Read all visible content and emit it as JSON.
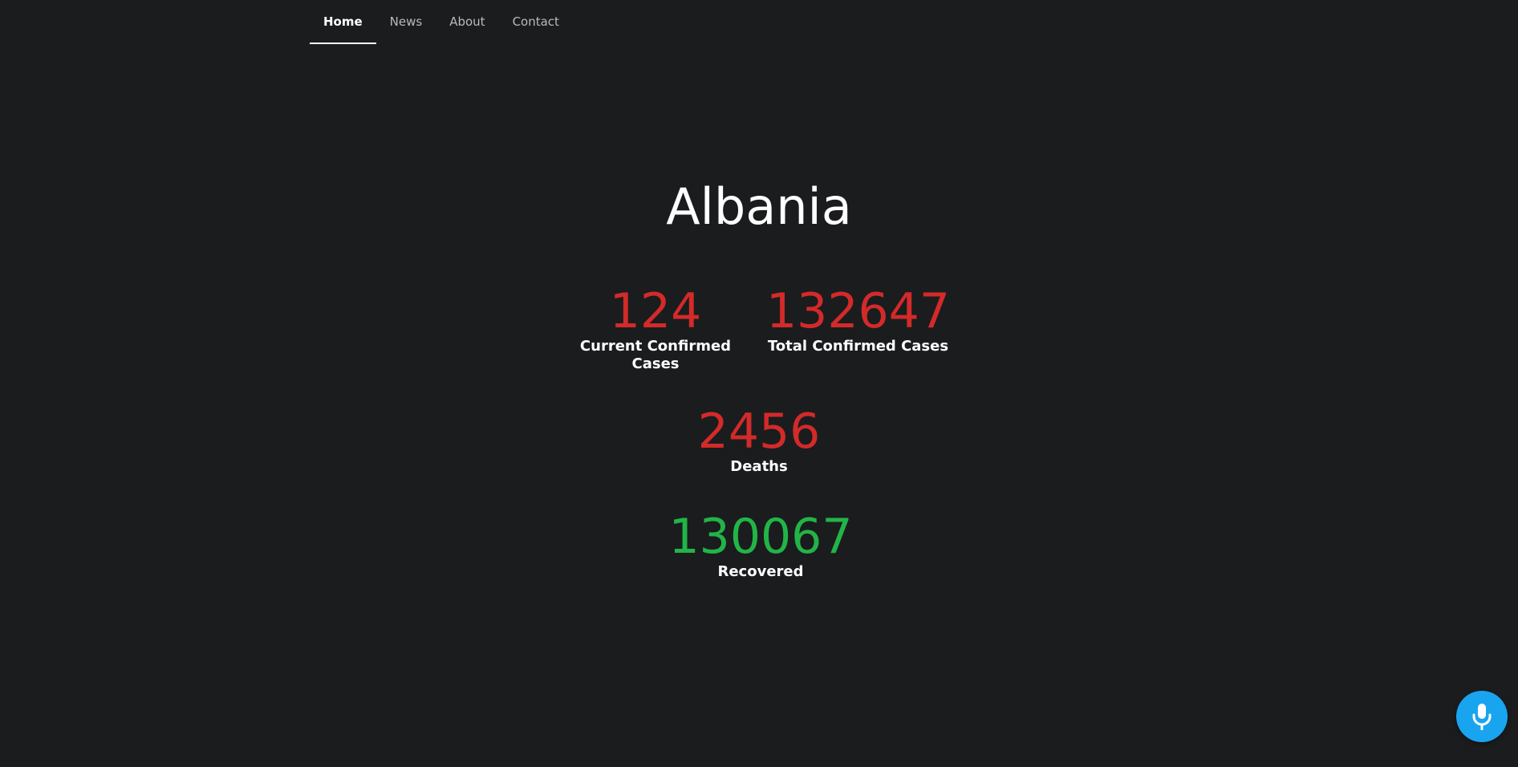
{
  "nav": {
    "items": [
      {
        "label": "Home",
        "active": true
      },
      {
        "label": "News",
        "active": false
      },
      {
        "label": "About",
        "active": false
      },
      {
        "label": "Contact",
        "active": false
      }
    ]
  },
  "country": "Albania",
  "stats": {
    "current_confirmed": {
      "value": "124",
      "label": "Current Confirmed Cases",
      "color": "#d32a2a"
    },
    "total_confirmed": {
      "value": "132647",
      "label": "Total Confirmed Cases",
      "color": "#d32a2a"
    },
    "deaths": {
      "value": "2456",
      "label": "Deaths",
      "color": "#d32a2a"
    },
    "recovered": {
      "value": "130067",
      "label": "Recovered",
      "color": "#22b447"
    }
  },
  "mic": {
    "icon": "microphone-icon",
    "color": "#19a4f0"
  }
}
